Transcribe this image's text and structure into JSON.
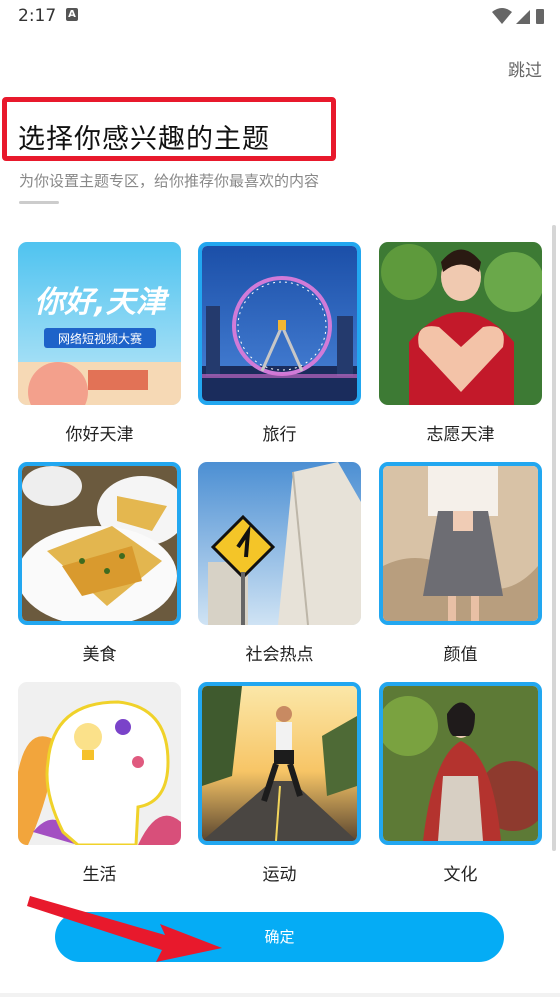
{
  "status": {
    "time": "2:17",
    "badge": "A"
  },
  "header": {
    "skip_label": "跳过",
    "title": "选择你感兴趣的主题",
    "subtitle": "为你设置主题专区，给你推荐你最喜欢的内容"
  },
  "topics": [
    {
      "label": "你好天津",
      "banner_title": "你好,天津",
      "banner_subtitle": "网络短视频大赛",
      "selected": false
    },
    {
      "label": "旅行",
      "selected": true
    },
    {
      "label": "志愿天津",
      "selected": false
    },
    {
      "label": "美食",
      "selected": true
    },
    {
      "label": "社会热点",
      "selected": false
    },
    {
      "label": "颜值",
      "selected": true
    },
    {
      "label": "生活",
      "selected": false
    },
    {
      "label": "运动",
      "selected": true
    },
    {
      "label": "文化",
      "selected": true
    }
  ],
  "confirm_label": "确定",
  "colors": {
    "accent": "#05acf5",
    "selected_border": "#22a7f0",
    "annotation_red": "#e8192c"
  }
}
